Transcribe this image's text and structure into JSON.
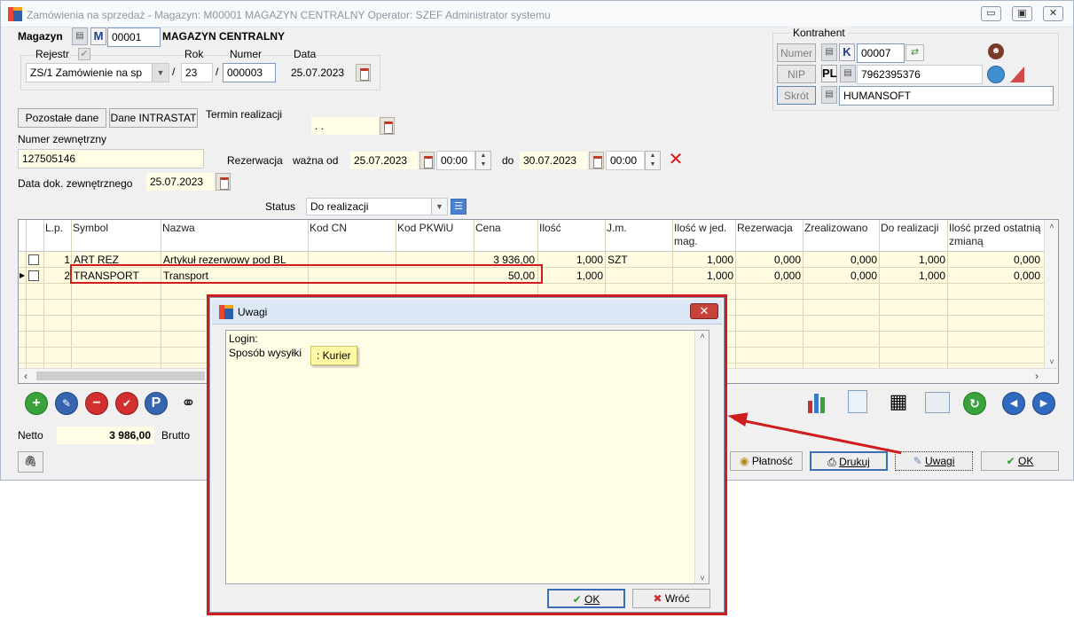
{
  "window": {
    "title": "Zamówienia na sprzedaż - Magazyn: M00001 MAGAZYN CENTRALNY  Operator: SZEF Administrator systemu",
    "controls": [
      "▭",
      "▣",
      "✕"
    ]
  },
  "header": {
    "magazyn_label": "Magazyn",
    "magazyn_letter": "M",
    "magazyn_code": "00001",
    "magazyn_name": "MAGAZYN CENTRALNY",
    "rejestr_label": "Rejestr",
    "rok_label": "Rok",
    "numer_label": "Numer",
    "data_label": "Data",
    "rejestr_value": "ZS/1 Zamówienie na sp",
    "slash1": "/",
    "rok_value": "23",
    "slash2": "/",
    "numer_value": "000003",
    "data_value": "25.07.2023"
  },
  "kontrahent": {
    "title": "Kontrahent",
    "numer_btn": "Numer",
    "nip_btn": "NIP",
    "skrot_btn": "Skrót",
    "k_letter": "K",
    "pl_letter": "PL",
    "numer_value": "00007",
    "nip_value": "7962395376",
    "skrot_value": "HUMANSOFT"
  },
  "form": {
    "pozostale_btn": "Pozostałe dane",
    "intrastat_btn": "Dane INTRASTAT",
    "termin_label": "Termin realizacji",
    "termin_value": " .  .",
    "numer_zew_label": "Numer zewnętrzny",
    "numer_zew_value": "127505146",
    "rezerwacja_label": "Rezerwacja",
    "wazna_od_label": "ważna od",
    "od_date": "25.07.2023",
    "od_time": "00:00",
    "do_label": "do",
    "do_date": "30.07.2023",
    "do_time": "00:00",
    "data_dok_label": "Data dok. zewnętrznego",
    "data_dok_value": "25.07.2023",
    "status_label": "Status",
    "status_value": "Do realizacji"
  },
  "grid": {
    "columns": [
      {
        "key": "lp",
        "label": "L.p."
      },
      {
        "key": "symbol",
        "label": "Symbol"
      },
      {
        "key": "nazwa",
        "label": "Nazwa"
      },
      {
        "key": "kodcn",
        "label": "Kod  CN"
      },
      {
        "key": "pkwiu",
        "label": "Kod  PKWiU"
      },
      {
        "key": "cena",
        "label": "Cena"
      },
      {
        "key": "ilosc",
        "label": "Ilość"
      },
      {
        "key": "jm",
        "label": "J.m."
      },
      {
        "key": "ilosc_mag",
        "label": "Ilość w jed. mag."
      },
      {
        "key": "rezerwacja",
        "label": "Rezerwacja"
      },
      {
        "key": "zrealizowano",
        "label": "Zrealizowano"
      },
      {
        "key": "do_realizacji",
        "label": "Do realizacji"
      },
      {
        "key": "ilosc_przed",
        "label": "Ilość przed ostatnią zmianą"
      }
    ],
    "rows": [
      {
        "lp": "1",
        "symbol": "ART REZ",
        "nazwa": "Artykuł rezerwowy pod BL",
        "kodcn": "",
        "pkwiu": "",
        "cena": "3 936,00",
        "ilosc": "1,000",
        "jm": "SZT",
        "ilosc_mag": "1,000",
        "rezerwacja": "0,000",
        "zrealizowano": "0,000",
        "do_realizacji": "1,000",
        "ilosc_przed": "0,000"
      },
      {
        "lp": "2",
        "symbol": "TRANSPORT",
        "nazwa": "Transport",
        "kodcn": "",
        "pkwiu": "",
        "cena": "50,00",
        "ilosc": "1,000",
        "jm": "",
        "ilosc_mag": "1,000",
        "rezerwacja": "0,000",
        "zrealizowano": "0,000",
        "do_realizacji": "1,000",
        "ilosc_przed": "0,000"
      }
    ]
  },
  "totals": {
    "netto_label": "Netto",
    "netto_value": "3 986,00",
    "brutto_label": "Brutto"
  },
  "footer": {
    "platnosc_btn": "Płatność",
    "drukuj_btn": "Drukuj",
    "uwagi_btn": "Uwagi",
    "ok_btn": "OK"
  },
  "dialog": {
    "title": "Uwagi",
    "line1": "Login:",
    "line2": "Sposób wysyłki",
    "tooltip": ": Kurier",
    "ok_btn": "OK",
    "cancel_btn": "Wróć"
  },
  "colors": {
    "highlight": "#d01c1c",
    "field_bg": "#fffde6",
    "grid_bg": "#fffbe0"
  }
}
